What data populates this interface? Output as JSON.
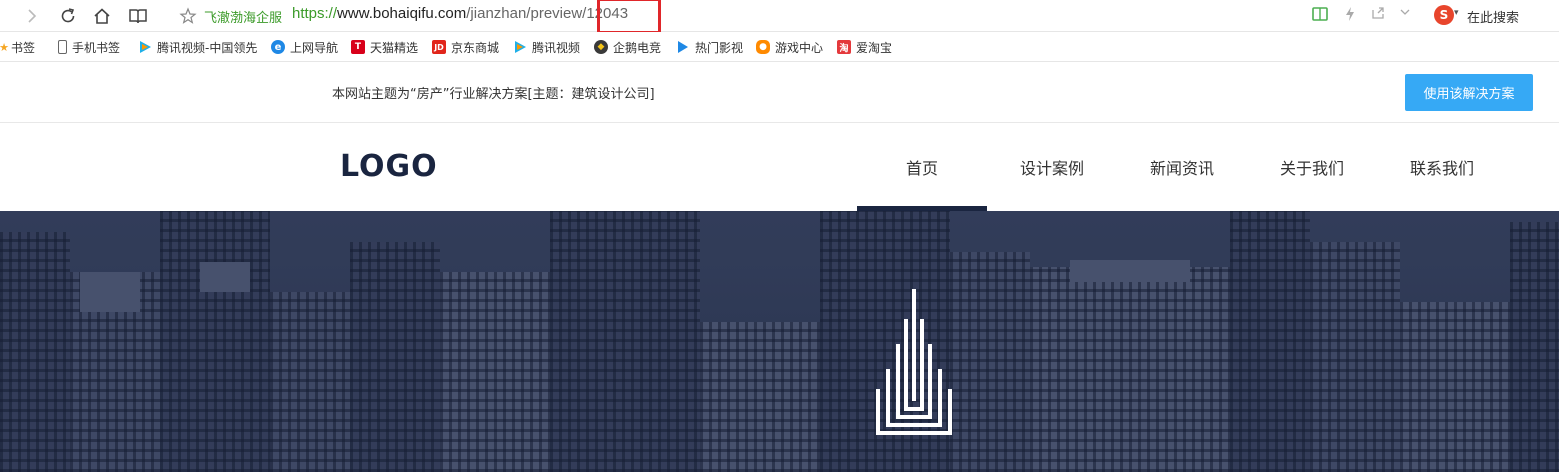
{
  "browser": {
    "site_name": "飞澈渤海企服",
    "url_proto": "https://",
    "url_host": "www.bohaiqifu.com",
    "url_path": "/jianzhan/preview/",
    "url_id": "12043",
    "search_engine_icon": "sogou-icon",
    "search_label": "在此搜索"
  },
  "bookmarks": [
    {
      "label": "书签",
      "icon": "star-icon",
      "color": "#f5a623"
    },
    {
      "label": "手机书签",
      "icon": "phone-icon",
      "color": "#666666"
    },
    {
      "label": "腾讯视频-中国领先",
      "icon": "tencent-video-icon",
      "color": "#20b0e8"
    },
    {
      "label": "上网导航",
      "icon": "ie-icon",
      "color": "#1e88e5"
    },
    {
      "label": "天猫精选",
      "icon": "tmall-icon",
      "color": "#d8001a"
    },
    {
      "label": "京东商城",
      "icon": "jd-icon",
      "color": "#e1251b"
    },
    {
      "label": "腾讯视频",
      "icon": "tencent-video-icon",
      "color": "#20b0e8"
    },
    {
      "label": "企鹅电竞",
      "icon": "penguin-esports-icon",
      "color": "#3a3a3a"
    },
    {
      "label": "热门影视",
      "icon": "play-icon",
      "color": "#1e88e5"
    },
    {
      "label": "游戏中心",
      "icon": "gamepad-icon",
      "color": "#ff8a00"
    },
    {
      "label": "爱淘宝",
      "icon": "taobao-icon",
      "color": "#e4393c"
    }
  ],
  "notice": {
    "text": "本网站主题为“房产”行业解决方案[主题：建筑设计公司]",
    "button": "使用该解决方案"
  },
  "header": {
    "logo": "LOGO",
    "nav": [
      "首页",
      "设计案例",
      "新闻资讯",
      "关于我们",
      "联系我们"
    ],
    "active_index": 0
  },
  "colors": {
    "accent": "#36a9f5",
    "brand_dark": "#1a2540",
    "url_green": "#3c9b2a",
    "highlight_red": "#e0262a"
  }
}
